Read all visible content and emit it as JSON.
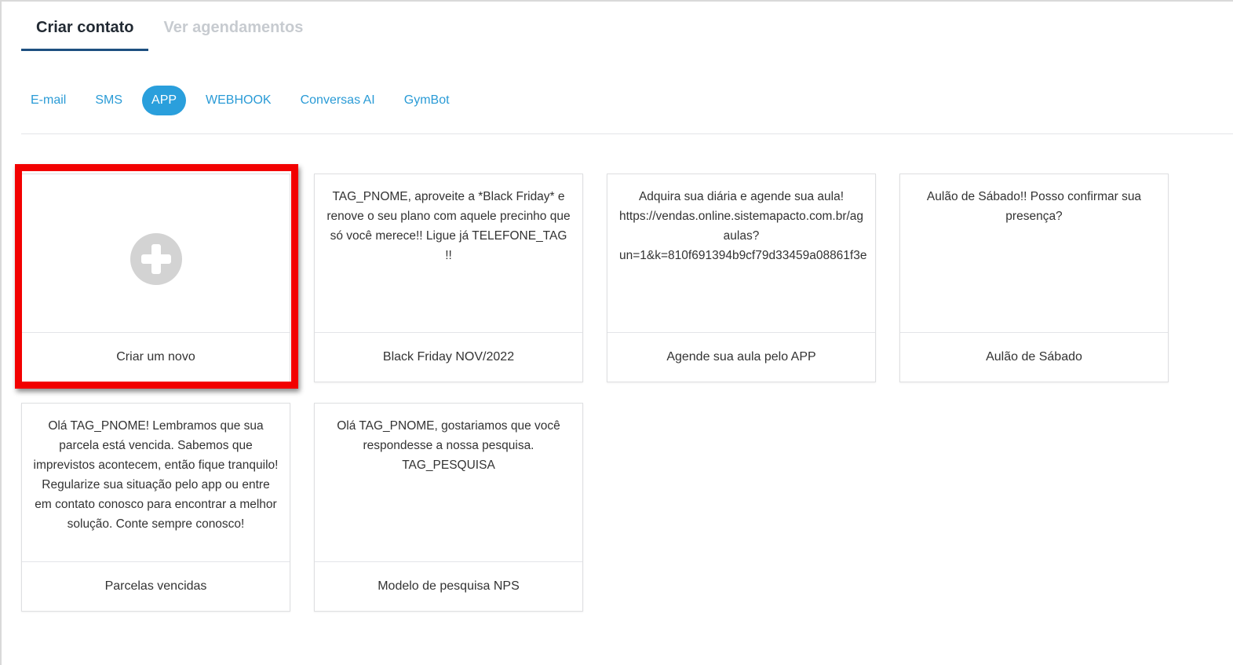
{
  "top_tabs": [
    {
      "label": "Criar contato",
      "active": true
    },
    {
      "label": "Ver agendamentos",
      "active": false
    }
  ],
  "channels": [
    {
      "label": "E-mail",
      "active": false
    },
    {
      "label": "SMS",
      "active": false
    },
    {
      "label": "APP",
      "active": true
    },
    {
      "label": "WEBHOOK",
      "active": false
    },
    {
      "label": "Conversas AI",
      "active": false
    },
    {
      "label": "GymBot",
      "active": false
    }
  ],
  "new_card": {
    "label": "Criar um novo",
    "icon": "plus-circle-icon"
  },
  "templates": [
    {
      "body": "TAG_PNOME, aproveite a *Black Friday* e renove o seu plano com aquele precinho que só você merece!! Ligue já TELEFONE_TAG !!",
      "title": "Black Friday NOV/2022"
    },
    {
      "body_lines": [
        "Adquira sua diária e agende sua aula!",
        "https://vendas.online.sistemapacto.com.br/ag",
        "aulas?",
        "un=1&k=810f691394b9cf79d33459a08861f3e"
      ],
      "title": "Agende sua aula pelo APP"
    },
    {
      "body": "Aulão de Sábado!! Posso confirmar sua presença?",
      "title": "Aulão de Sábado"
    },
    {
      "body": "Olá TAG_PNOME! Lembramos que sua parcela está vencida. Sabemos que imprevistos acontecem, então fique tranquilo! Regularize sua situação pelo app ou entre em contato conosco para encontrar a melhor solução. Conte sempre conosco!",
      "title": "Parcelas vencidas"
    },
    {
      "body": "Olá TAG_PNOME, gostariamos que você respondesse a nossa pesquisa. TAG_PESQUISA",
      "title": "Modelo de pesquisa NPS"
    }
  ],
  "colors": {
    "accent": "#2a9fdc",
    "tab_underline": "#1d4f80",
    "highlight": "#f20000"
  }
}
